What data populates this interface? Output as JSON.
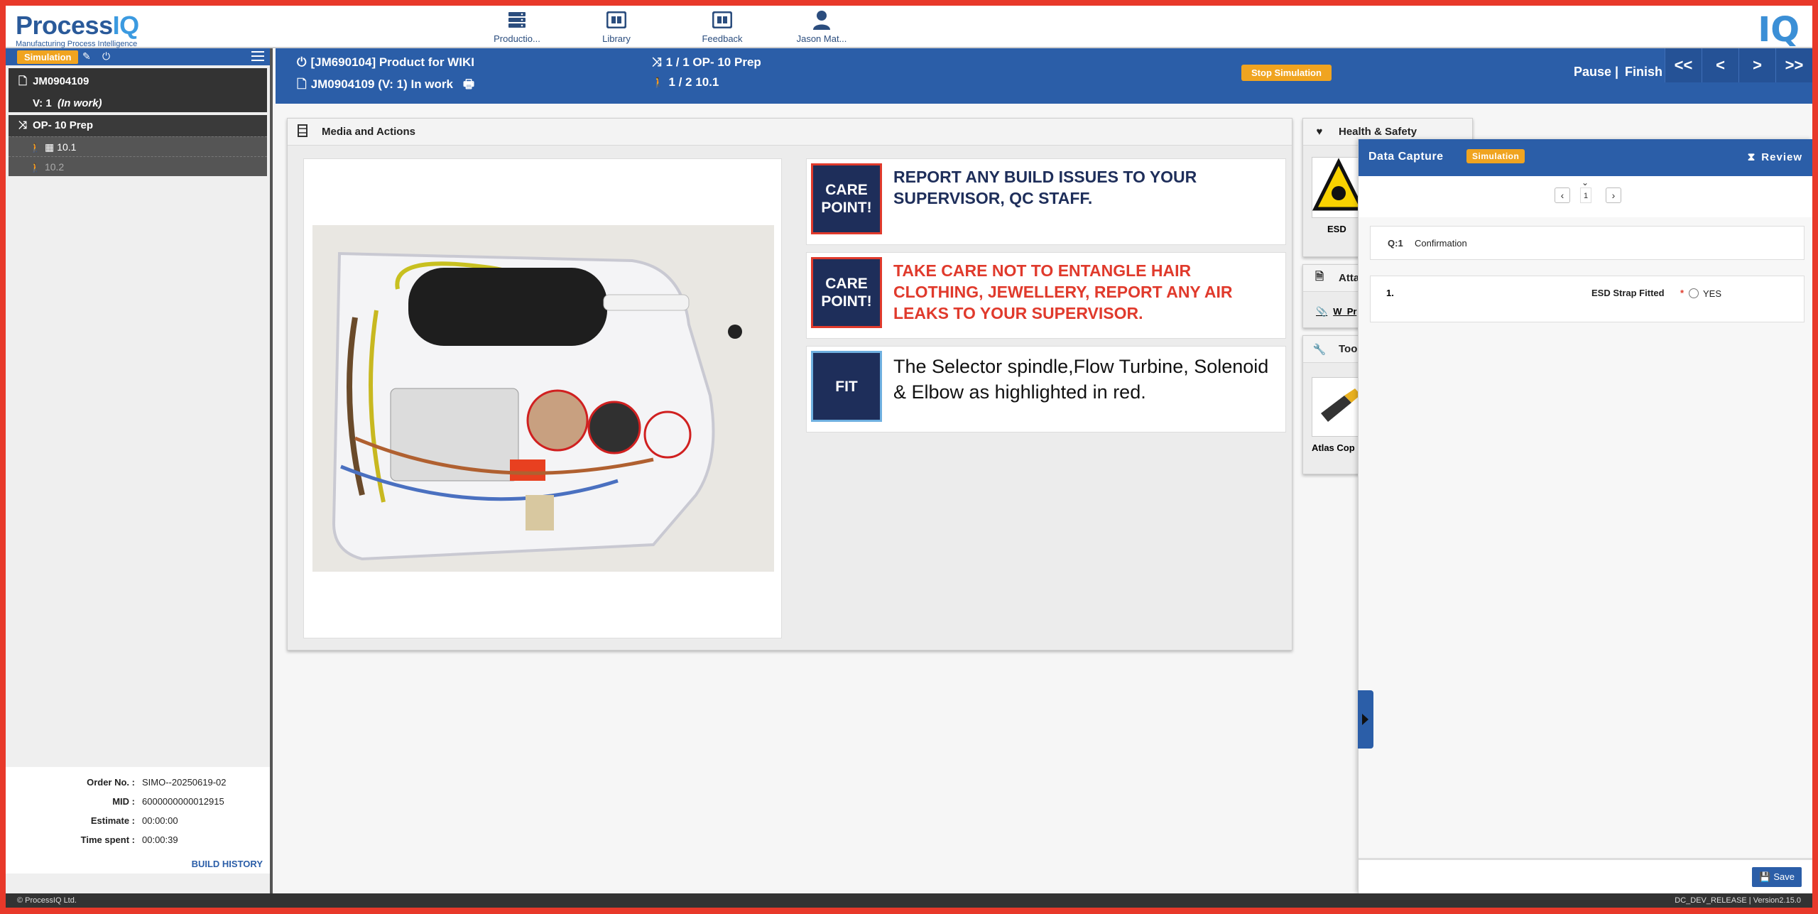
{
  "brand": {
    "logo_main": "Process",
    "logo_accent": "IQ",
    "tagline": "Manufacturing Process Intelligence",
    "mark": "IQ"
  },
  "nav": [
    {
      "label": "Productio...",
      "icon": "server-stack-icon"
    },
    {
      "label": "Library",
      "icon": "library-icon"
    },
    {
      "label": "Feedback",
      "icon": "feedback-icon"
    },
    {
      "label": "Jason Mat...",
      "icon": "user-icon"
    }
  ],
  "sidebar": {
    "simulation_badge": "Simulation",
    "job_id": "JM0904109",
    "version": "V: 1",
    "status": "(In work)",
    "operation": "OP- 10 Prep",
    "steps": [
      "10.1",
      "10.2"
    ],
    "info": {
      "order_label": "Order No. :",
      "order_value": "SIMO--20250619-02",
      "mid_label": "MID :",
      "mid_value": "6000000000012915",
      "estimate_label": "Estimate :",
      "estimate_value": "00:00:00",
      "timespent_label": "Time spent :",
      "timespent_value": "00:00:39"
    },
    "build_history": "BUILD HISTORY"
  },
  "header": {
    "product": "[JM690104] Product for WIKI",
    "job_line": "JM0904109  (V: 1)  In work",
    "op_progress": "1 / 1 OP- 10 Prep",
    "step_progress": "1 / 2 10.1",
    "stop_simulation": "Stop Simulation",
    "pause": "Pause |",
    "finish": "Finish",
    "nav_first": "<<",
    "nav_prev": "<",
    "nav_next": ">",
    "nav_last": ">>"
  },
  "media": {
    "title": "Media and Actions",
    "cards": [
      {
        "badge": "CARE POINT!",
        "text": "REPORT ANY BUILD ISSUES TO YOUR SUPERVISOR, QC STAFF."
      },
      {
        "badge": "CARE POINT!",
        "text": "TAKE CARE NOT TO ENTANGLE HAIR CLOTHING, JEWELLERY, REPORT ANY AIR LEAKS TO YOUR SUPERVISOR."
      },
      {
        "badge": "FIT",
        "text": "The Selector spindle,Flow Turbine, Solenoid & Elbow as highlighted in red."
      }
    ]
  },
  "right_panels": {
    "health_safety": "Health & Safety",
    "esd_label": "ESD",
    "attachments": "Atta",
    "attachment_link": "W_Pr",
    "tools": "Tool",
    "tool_label": "Atlas Cop"
  },
  "data_capture": {
    "title": "Data Capture",
    "simulation": "Simulation",
    "review": "Review",
    "page": "1",
    "question_no": "Q:1",
    "question": "Confirmation",
    "item_no": "1.",
    "item_label": "ESD Strap Fitted",
    "required_mark": "*",
    "option": "YES",
    "save": "Save"
  },
  "footer": {
    "left": "© ProcessIQ Ltd.",
    "right": "DC_DEV_RELEASE  | Version2.15.0"
  },
  "colors": {
    "brand_blue": "#2b5ea8",
    "accent_orange": "#f0a420",
    "care_red": "#e03a2c",
    "badge_navy": "#1e2e5a"
  }
}
